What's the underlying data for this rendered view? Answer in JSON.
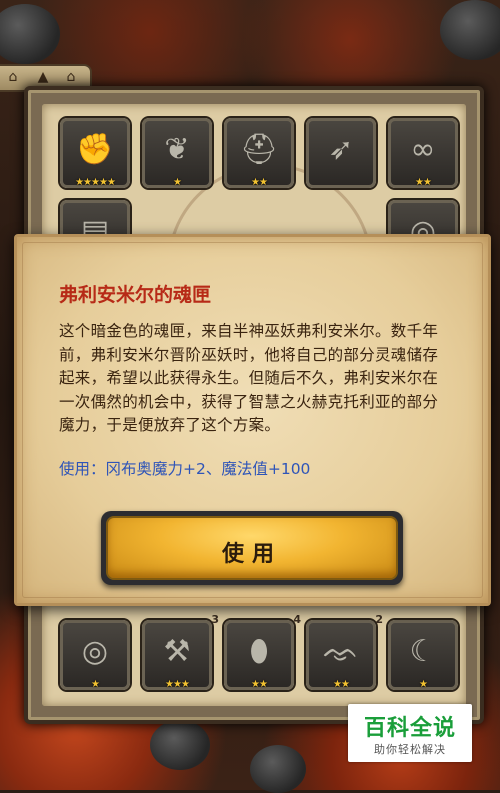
{
  "inventory": {
    "top_row": [
      {
        "icon": "gauntlet-icon",
        "glyph": "✊",
        "stars": "★★★★★"
      },
      {
        "icon": "dragon-crest-icon",
        "glyph": "❦",
        "stars": "★"
      },
      {
        "icon": "helmet-icon",
        "glyph": "⛑",
        "stars": "★★"
      },
      {
        "icon": "crossbow-icon",
        "glyph": "➶",
        "stars": ""
      },
      {
        "icon": "chain-amulet-icon",
        "glyph": "∞",
        "stars": "★★"
      }
    ],
    "second_row": [
      {
        "icon": "belt-icon",
        "glyph": "▤",
        "stars": ""
      },
      {
        "icon": "ring-icon",
        "glyph": "◎",
        "stars": ""
      }
    ],
    "bottom_row": [
      {
        "icon": "ring-icon",
        "glyph": "◎",
        "stars": "★",
        "count": ""
      },
      {
        "icon": "anvil-icon",
        "glyph": "⚒",
        "stars": "★★★",
        "count": "3"
      },
      {
        "icon": "leather-pouch-icon",
        "glyph": "⬮",
        "stars": "★★",
        "count": "4"
      },
      {
        "icon": "bat-wing-icon",
        "glyph": "ᨎ",
        "stars": "★★",
        "count": "2"
      },
      {
        "icon": "horn-icon",
        "glyph": "☾",
        "stars": "★",
        "count": ""
      }
    ]
  },
  "dialog": {
    "title": "弗利安米尔的魂匣",
    "description": "这个暗金色的魂匣，来自半神巫妖弗利安米尔。数千年前，弗利安米尔晋阶巫妖时，他将自己的部分灵魂储存起来，希望以此获得永生。但随后不久，弗利安米尔在一次偶然的机会中，获得了智慧之火赫克托利亚的部分魔力，于是便放弃了这个方案。",
    "usage": "使用：冈布奥魔力+2、魔法值+100",
    "use_button": "使用"
  },
  "watermark": {
    "brand": "百科全说",
    "subtitle": "助你轻松解决"
  },
  "colors": {
    "title_red": "#b72a17",
    "usage_blue": "#2f55b8",
    "button_gold": "#f2b531",
    "watermark_green": "#1a9e3a"
  }
}
